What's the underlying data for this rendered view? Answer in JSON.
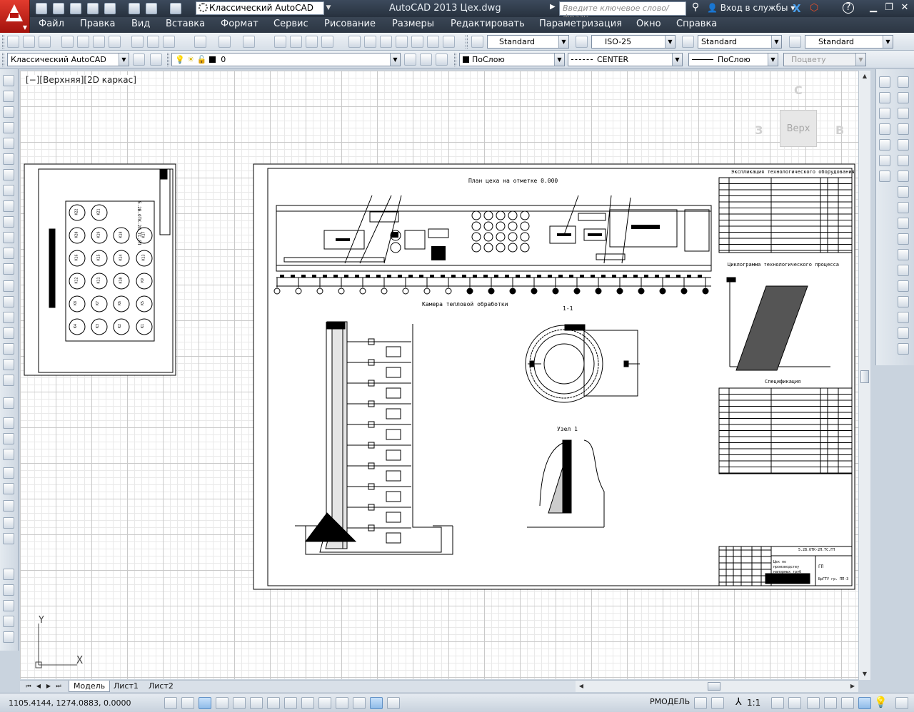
{
  "title_bar": {
    "workspace": "Классический AutoCAD",
    "app_title": "AutoCAD 2013    Цех.dwg",
    "search_placeholder": "Введите ключевое слово/фразу",
    "login": "Вход в службы"
  },
  "menu": [
    "Файл",
    "Правка",
    "Вид",
    "Вставка",
    "Формат",
    "Сервис",
    "Рисование",
    "Размеры",
    "Редактировать",
    "Параметризация",
    "Окно",
    "Справка"
  ],
  "styles_toolbar": {
    "text_style": "Standard",
    "dim_style": "ISO-25",
    "table_style": "Standard",
    "multileader_style": "Standard"
  },
  "layers_toolbar": {
    "workspace": "Классический AutoCAD",
    "layer": "0",
    "color": "ПоСлою",
    "linetype": "CENTER",
    "lineweight": "ПоСлою",
    "plot_style": "Поцвету"
  },
  "viewport": {
    "label": "[−][Верхняя][2D каркас]",
    "viewcube_face": "Верх",
    "viewcube_n": "С",
    "viewcube_w": "З",
    "viewcube_e": "В",
    "ucs_x": "X",
    "ucs_y": "Y"
  },
  "drawing": {
    "plan_title": "План цеха на отметке 0.000",
    "chamber_title": "Камера тепловой обработки",
    "section_title": "1-1",
    "node_title": "Узел 1",
    "explication_title": "Экспликация технологического оборудования",
    "cycle_title": "Циклограмма технологического процесса",
    "spec_title": "Спецификация",
    "stamp_code": "5.2В.ОТК-2П.ТС.ГП",
    "stamp_name": "Цех по производству напорных труб",
    "stamp_sheet": "ГП",
    "stamp_org": "БрГТУ гр. ПП-3",
    "left_sheet_code": "5.2В.ОТК-2П.ТС-ГП",
    "chamber_labels": [
      "К22",
      "К21",
      "К20",
      "К19",
      "К18",
      "К17",
      "К16",
      "К15",
      "К14",
      "К13",
      "К12",
      "К11",
      "К10",
      "К9",
      "К8",
      "К7",
      "К6",
      "К5",
      "К4",
      "К3",
      "К2",
      "К1"
    ]
  },
  "layout_tabs": [
    "Модель",
    "Лист1",
    "Лист2"
  ],
  "status_bar": {
    "coords": "1105.4144, 1274.0883, 0.0000",
    "model": "РМОДЕЛЬ",
    "scale": "1:1"
  },
  "colors": {
    "title_bar": "#2f3a48",
    "canvas": "#ffffff",
    "grid": "#c9c9c9",
    "logo": "#d02a1f"
  }
}
